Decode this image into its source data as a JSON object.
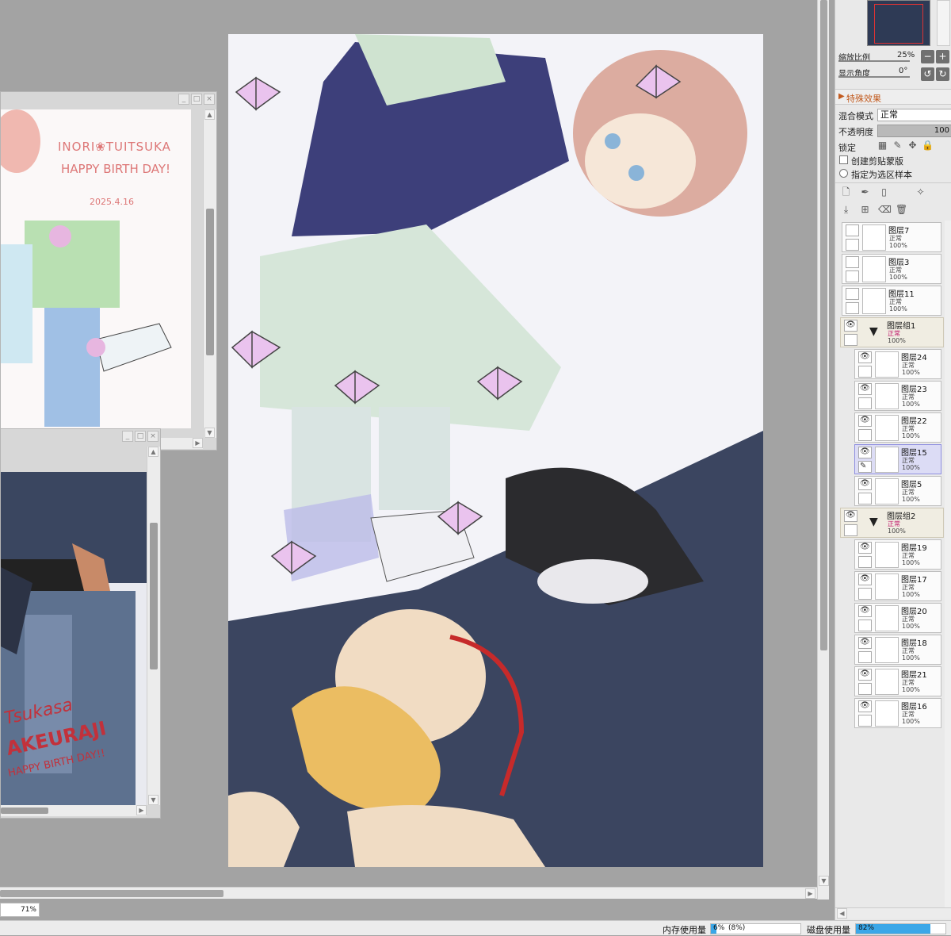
{
  "subwindow_top": {
    "artwork_text": {
      "line1": "INORI❀TUITSUKA",
      "line2": "HAPPY BIRTH DAY!",
      "date": "2025.4.16"
    }
  },
  "subwindow_bottom": {
    "artwork_text": {
      "line1": "Tsukasa",
      "line2": "AKEURAJI",
      "line3": "HAPPY BIRTH DAY!!"
    }
  },
  "panel": {
    "zoom_label": "缩放比例",
    "zoom_value": "25%",
    "angle_label": "显示角度",
    "angle_value": "0°",
    "effects_label": "特殊效果",
    "blend_label": "混合模式",
    "blend_value": "正常",
    "opacity_label": "不透明度",
    "opacity_value": "100",
    "lock_label": "锁定",
    "clip_label": "创建剪贴蒙版",
    "sample_label": "指定为选区样本",
    "layers": [
      {
        "name": "图层7",
        "mode": "正常",
        "opacity": "100%",
        "kind": "layer",
        "visible": false
      },
      {
        "name": "图层3",
        "mode": "正常",
        "opacity": "100%",
        "kind": "layer",
        "visible": false
      },
      {
        "name": "图层11",
        "mode": "正常",
        "opacity": "100%",
        "kind": "layer",
        "visible": false
      },
      {
        "name": "图层组1",
        "mode": "正常",
        "opacity": "100%",
        "kind": "group",
        "visible": true
      },
      {
        "name": "图层24",
        "mode": "正常",
        "opacity": "100%",
        "kind": "sub",
        "visible": true
      },
      {
        "name": "图层23",
        "mode": "正常",
        "opacity": "100%",
        "kind": "sub",
        "visible": true
      },
      {
        "name": "图层22",
        "mode": "正常",
        "opacity": "100%",
        "kind": "sub",
        "visible": true
      },
      {
        "name": "图层15",
        "mode": "正常",
        "opacity": "100%",
        "kind": "sub",
        "visible": true,
        "selected": true
      },
      {
        "name": "图层5",
        "mode": "正常",
        "opacity": "100%",
        "kind": "sub",
        "visible": true
      },
      {
        "name": "图层组2",
        "mode": "正常",
        "opacity": "100%",
        "kind": "group",
        "visible": true
      },
      {
        "name": "图层19",
        "mode": "正常",
        "opacity": "100%",
        "kind": "sub",
        "visible": true
      },
      {
        "name": "图层17",
        "mode": "正常",
        "opacity": "100%",
        "kind": "sub",
        "visible": true
      },
      {
        "name": "图层20",
        "mode": "正常",
        "opacity": "100%",
        "kind": "sub",
        "visible": true
      },
      {
        "name": "图层18",
        "mode": "正常",
        "opacity": "100%",
        "kind": "sub",
        "visible": true
      },
      {
        "name": "图层21",
        "mode": "正常",
        "opacity": "100%",
        "kind": "sub",
        "visible": true
      },
      {
        "name": "图层16",
        "mode": "正常",
        "opacity": "100%",
        "kind": "sub",
        "visible": true
      }
    ]
  },
  "statusbar": {
    "zoom": "71%",
    "memory_label": "内存使用量",
    "memory_value": "6%",
    "memory_paren": "(8%)",
    "disk_label": "磁盘使用量",
    "disk_value": "82%"
  },
  "colors": {
    "workspace": "#a3a3a3",
    "canvas_bg": "#f3f3f8",
    "selected_layer": "#dcdcf5",
    "disk_bar": "#3aa7e8",
    "effects_accent": "#c25a1e"
  }
}
